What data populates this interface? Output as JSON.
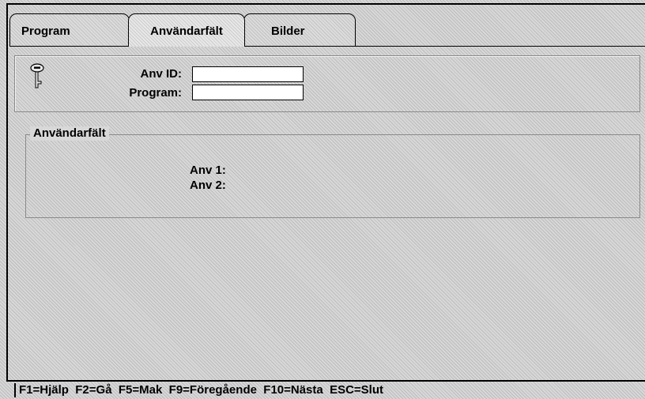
{
  "tabs": [
    {
      "label": "Program"
    },
    {
      "label": "Användarfält"
    },
    {
      "label": "Bilder"
    }
  ],
  "header": {
    "icon": "key-icon",
    "anv_id_label": "Anv ID:",
    "anv_id_value": "",
    "program_label": "Program:",
    "program_value": ""
  },
  "group": {
    "title": "Användarfält",
    "anv1_label": "Anv 1:",
    "anv2_label": "Anv 2:"
  },
  "status_bar": {
    "text": "F1=Hjälp  F2=Gå  F5=Mak  F9=Föregående  F10=Nästa  ESC=Slut"
  }
}
